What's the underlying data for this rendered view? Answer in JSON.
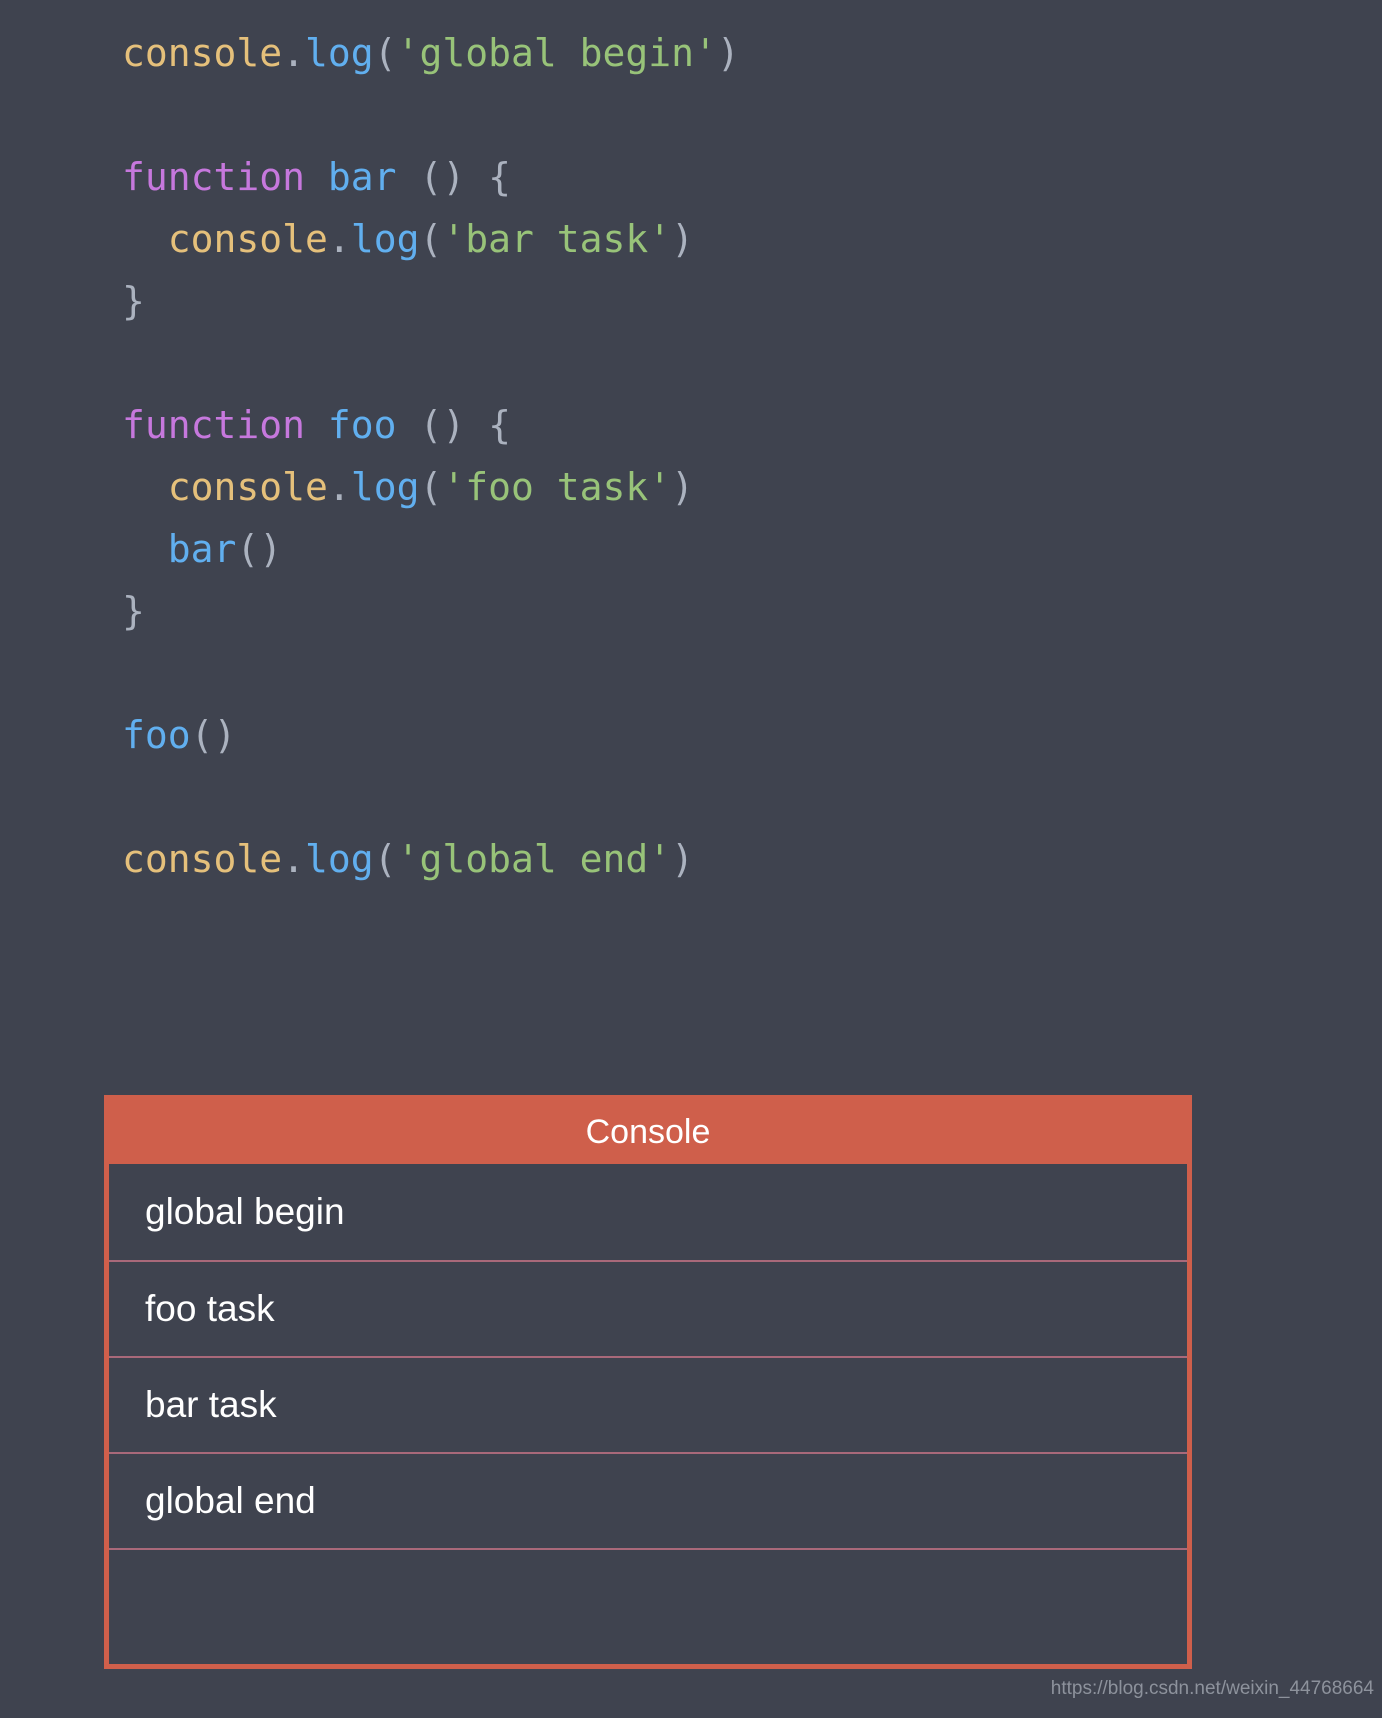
{
  "theme": {
    "background": "#3f434f",
    "accent": "#cf5f4b",
    "keyword_color": "#c678dd",
    "object_color": "#e5c07b",
    "function_color": "#61afef",
    "string_color": "#98c379",
    "punctuation_color": "#abb2bf",
    "row_divider_color": "#a9697a",
    "text_color": "#ffffff"
  },
  "code": {
    "language": "javascript",
    "lines": [
      {
        "tokens": [
          {
            "t": "console",
            "c": "tok-obj"
          },
          {
            "t": ".",
            "c": "tok-punc"
          },
          {
            "t": "log",
            "c": "tok-fn"
          },
          {
            "t": "(",
            "c": "tok-punc"
          },
          {
            "t": "'global begin'",
            "c": "tok-str"
          },
          {
            "t": ")",
            "c": "tok-punc"
          }
        ]
      },
      {
        "tokens": []
      },
      {
        "tokens": [
          {
            "t": "function",
            "c": "tok-kw"
          },
          {
            "t": " ",
            "c": "tok-punc"
          },
          {
            "t": "bar",
            "c": "tok-fn"
          },
          {
            "t": " () {",
            "c": "tok-punc"
          }
        ]
      },
      {
        "tokens": [
          {
            "t": "  ",
            "c": "tok-punc"
          },
          {
            "t": "console",
            "c": "tok-obj"
          },
          {
            "t": ".",
            "c": "tok-punc"
          },
          {
            "t": "log",
            "c": "tok-fn"
          },
          {
            "t": "(",
            "c": "tok-punc"
          },
          {
            "t": "'bar task'",
            "c": "tok-str"
          },
          {
            "t": ")",
            "c": "tok-punc"
          }
        ]
      },
      {
        "tokens": [
          {
            "t": "}",
            "c": "tok-punc"
          }
        ]
      },
      {
        "tokens": []
      },
      {
        "tokens": [
          {
            "t": "function",
            "c": "tok-kw"
          },
          {
            "t": " ",
            "c": "tok-punc"
          },
          {
            "t": "foo",
            "c": "tok-fn"
          },
          {
            "t": " () {",
            "c": "tok-punc"
          }
        ]
      },
      {
        "tokens": [
          {
            "t": "  ",
            "c": "tok-punc"
          },
          {
            "t": "console",
            "c": "tok-obj"
          },
          {
            "t": ".",
            "c": "tok-punc"
          },
          {
            "t": "log",
            "c": "tok-fn"
          },
          {
            "t": "(",
            "c": "tok-punc"
          },
          {
            "t": "'foo task'",
            "c": "tok-str"
          },
          {
            "t": ")",
            "c": "tok-punc"
          }
        ]
      },
      {
        "tokens": [
          {
            "t": "  ",
            "c": "tok-punc"
          },
          {
            "t": "bar",
            "c": "tok-fn"
          },
          {
            "t": "()",
            "c": "tok-punc"
          }
        ]
      },
      {
        "tokens": [
          {
            "t": "}",
            "c": "tok-punc"
          }
        ]
      },
      {
        "tokens": []
      },
      {
        "tokens": [
          {
            "t": "foo",
            "c": "tok-fn"
          },
          {
            "t": "()",
            "c": "tok-punc"
          }
        ]
      },
      {
        "tokens": []
      },
      {
        "tokens": [
          {
            "t": "console",
            "c": "tok-obj"
          },
          {
            "t": ".",
            "c": "tok-punc"
          },
          {
            "t": "log",
            "c": "tok-fn"
          },
          {
            "t": "(",
            "c": "tok-punc"
          },
          {
            "t": "'global end'",
            "c": "tok-str"
          },
          {
            "t": ")",
            "c": "tok-punc"
          }
        ]
      }
    ]
  },
  "console": {
    "title": "Console",
    "rows": [
      "global begin",
      "foo task",
      "bar task",
      "global end",
      ""
    ]
  },
  "watermark": {
    "text": "https://blog.csdn.net/weixin_44768664"
  }
}
